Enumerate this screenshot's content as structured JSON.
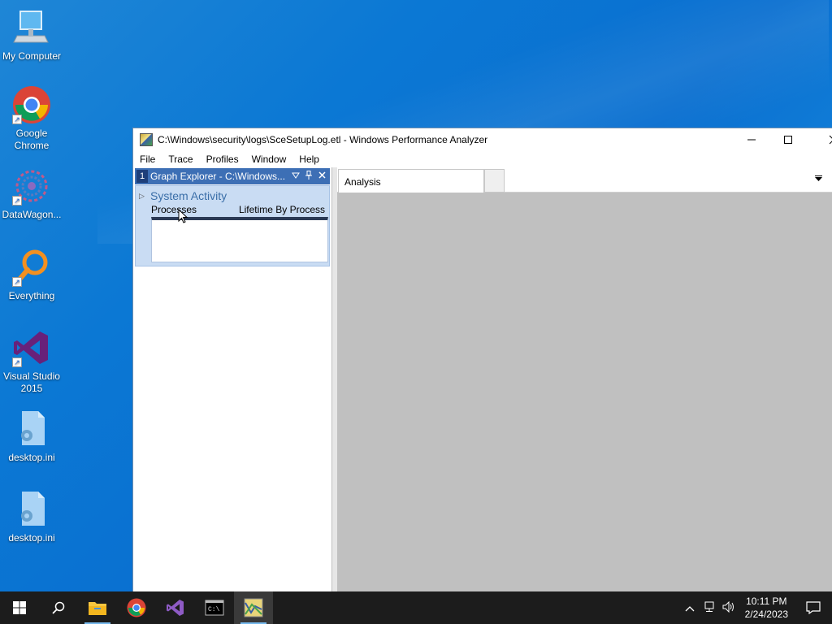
{
  "desktop": {
    "icons": [
      {
        "label": "My Computer",
        "icon": "computer-icon"
      },
      {
        "label": "Google Chrome",
        "icon": "chrome-icon"
      },
      {
        "label": "DataWagon...",
        "icon": "datawagon-icon"
      },
      {
        "label": "Everything",
        "icon": "everything-icon"
      },
      {
        "label": "Visual Studio 2015",
        "icon": "visual-studio-icon"
      },
      {
        "label": "desktop.ini",
        "icon": "ini-file-icon"
      },
      {
        "label": "desktop.ini",
        "icon": "ini-file-icon"
      }
    ]
  },
  "window": {
    "title": "C:\\Windows\\security\\logs\\SceSetupLog.etl - Windows Performance Analyzer",
    "controls": {
      "minimize": "—",
      "maximize": "☐",
      "close": "✕"
    },
    "menu": [
      "File",
      "Trace",
      "Profiles",
      "Window",
      "Help"
    ]
  },
  "graph_explorer": {
    "number": "1",
    "title": "Graph Explorer - C:\\Windows...",
    "category": "System Activity",
    "thumb_left": "Processes",
    "thumb_right": "Lifetime By Process"
  },
  "analysis": {
    "tab_label": "Analysis"
  },
  "taskbar": {
    "time": "10:11 PM",
    "date": "2/24/2023"
  },
  "colors": {
    "pane_header": "#3d6fb5",
    "graph_bg": "#c9dcf3",
    "analysis_bg": "#c0c0c0",
    "taskbar": "#1c1c1c"
  }
}
